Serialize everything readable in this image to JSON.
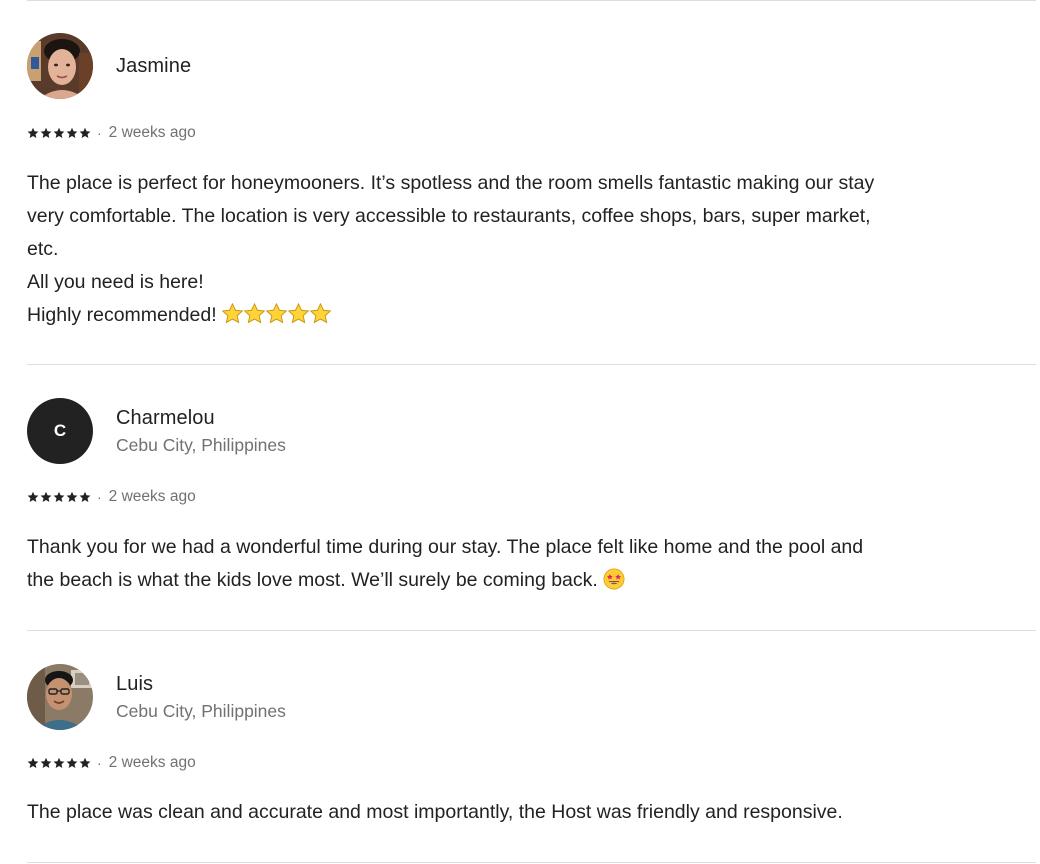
{
  "reviews": [
    {
      "name": "Jasmine",
      "location": "",
      "avatar_icon": "user-photo",
      "rating": 5,
      "separator": "·",
      "date": "2 weeks ago",
      "lines": [
        "The place is perfect for honeymooners. It’s spotless and the room smells fantastic making our stay",
        "very comfortable. The location is very accessible to restaurants, coffee shops, bars, super market,",
        "etc.",
        "All you need is here!",
        "Highly recommended!"
      ],
      "trailing_emoji": "five-gold-stars"
    },
    {
      "name": "Charmelou",
      "location": "Cebu City, Philippines",
      "avatar_initial": "C",
      "rating": 5,
      "separator": "·",
      "date": "2 weeks ago",
      "lines": [
        "Thank you for we had a wonderful time during our stay. The place felt like home and the pool and",
        "the beach is what the kids love most. We’ll surely be coming back."
      ],
      "trailing_emoji": "star-struck-face"
    },
    {
      "name": "Luis",
      "location": "Cebu City, Philippines",
      "avatar_icon": "user-photo",
      "rating": 5,
      "separator": "·",
      "date": "2 weeks ago",
      "lines": [
        "The place was clean and accurate and most importantly, the Host was friendly and responsive."
      ]
    }
  ],
  "colors": {
    "text": "#222222",
    "muted": "#717171",
    "divider": "#dddddd",
    "star": "#222222",
    "gold": "#f5c518"
  }
}
